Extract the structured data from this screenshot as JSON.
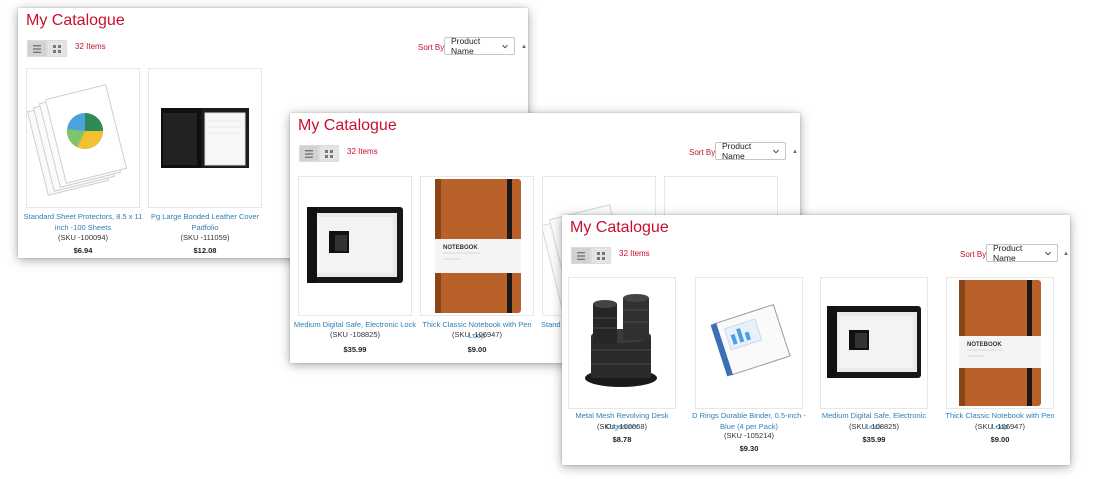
{
  "panels": [
    {
      "title": "My Catalogue",
      "item_count": "32 Items",
      "sort_label": "Sort By",
      "sort_value": "Product Name",
      "view_modes": [
        "list-view-icon",
        "grid-view-icon"
      ],
      "products": [
        {
          "name": "Standard Sheet Protectors, 8.5 x 11 inch -100 Sheets",
          "sku": "(SKU -100094)",
          "price": "$6.94",
          "image": "sheet-protectors"
        },
        {
          "name": "Pg Large Bonded Leather Cover Padfolio",
          "sku": "(SKU -111059)",
          "price": "$12.08",
          "image": "padfolio"
        }
      ]
    },
    {
      "title": "My Catalogue",
      "item_count": "32 Items",
      "sort_label": "Sort By",
      "sort_value": "Product Name",
      "view_modes": [
        "list-view-icon",
        "grid-view-icon"
      ],
      "products": [
        {
          "name": "Medium Digital Safe, Electronic Lock",
          "sku": "(SKU -108825)",
          "price": "$35.99",
          "image": "safe"
        },
        {
          "name": "Thick Classic Notebook with Pen Loop",
          "sku": "(SKU -106947)",
          "price": "$9.00",
          "image": "notebook"
        },
        {
          "name": "Stand",
          "image": "sheet-protectors"
        },
        {
          "name": "",
          "image": "blank"
        }
      ]
    },
    {
      "title": "My Catalogue",
      "item_count": "32 Items",
      "sort_label": "Sort By",
      "sort_value": "Product Name",
      "view_modes": [
        "list-view-icon",
        "grid-view-icon"
      ],
      "products": [
        {
          "name": "Metal Mesh Revolving Desk Organizer",
          "sku": "(SKU -100068)",
          "price": "$8.78",
          "image": "desk-organizer"
        },
        {
          "name": "D Rings Durable Binder, 0.5-inch - Blue (4 per Pack)",
          "sku": "(SKU -105214)",
          "price": "$9.30",
          "image": "binder"
        },
        {
          "name": "Medium Digital Safe, Electronic Lock",
          "sku": "(SKU -108825)",
          "price": "$35.99",
          "image": "safe"
        },
        {
          "name": "Thick Classic Notebook with Pen Loop",
          "sku": "(SKU -106947)",
          "price": "$9.00",
          "image": "notebook"
        }
      ]
    }
  ],
  "image_texts": {
    "notebook_cover": "NOTEBOOK"
  },
  "colors": {
    "accent": "#c8102e",
    "link": "#2e7fb5"
  }
}
